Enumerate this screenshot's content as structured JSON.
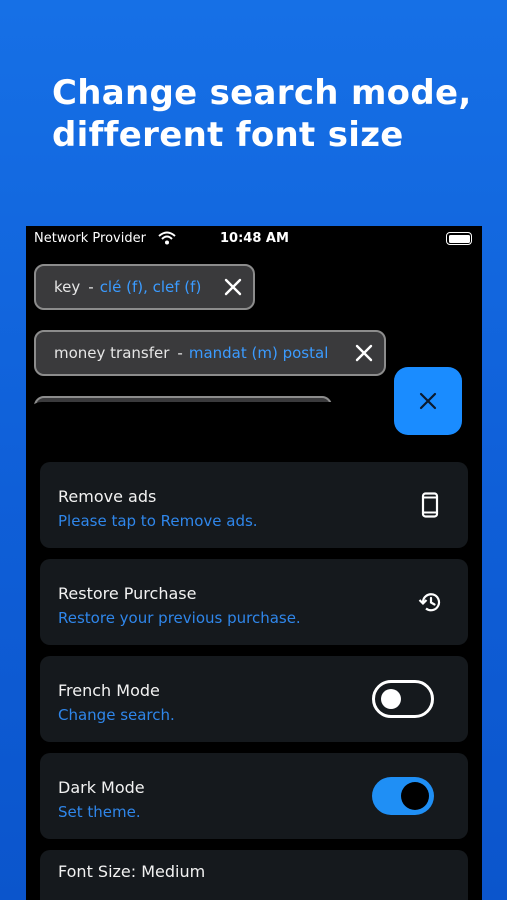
{
  "headline": {
    "line1": "Change search mode,",
    "line2": "different font size"
  },
  "status_bar": {
    "carrier": "Network Provider",
    "time": "10:48 AM",
    "icons": [
      "wifi-icon",
      "battery-icon"
    ]
  },
  "entries": [
    {
      "term": "key",
      "separator": "-",
      "translation": "clé (f), clef (f)"
    },
    {
      "term": "money transfer",
      "separator": "-",
      "translation": "mandat (m) postal"
    },
    {
      "term": "",
      "separator": "",
      "translation": ""
    }
  ],
  "settings": {
    "close_icon": "close-icon",
    "remove_ads": {
      "title": "Remove ads",
      "subtitle": "Please tap to Remove ads.",
      "icon": "phone-icon"
    },
    "restore_purchase": {
      "title": "Restore Purchase",
      "subtitle": "Restore your previous purchase.",
      "icon": "history-icon"
    },
    "french_mode": {
      "title": "French Mode",
      "subtitle": "Change search.",
      "enabled": false
    },
    "dark_mode": {
      "title": "Dark Mode",
      "subtitle": "Set theme.",
      "enabled": true
    },
    "font_size": {
      "title": "Font Size: Medium"
    }
  },
  "colors": {
    "background_blue": "#1670e6",
    "accent_blue": "#1a8cff",
    "link_blue": "#2f86ea",
    "card_bg": "#15191d"
  }
}
